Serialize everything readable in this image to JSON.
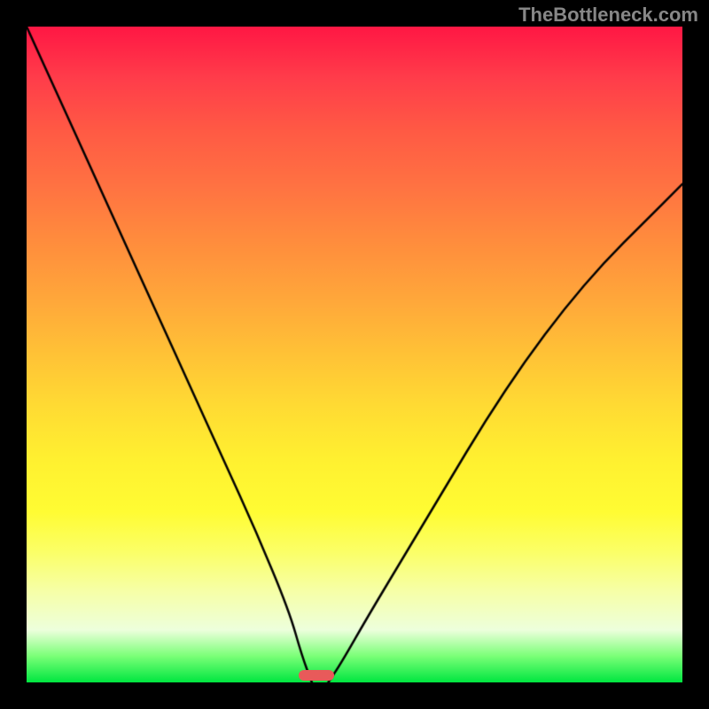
{
  "watermark": "TheBottleneck.com",
  "chart_data": {
    "type": "line",
    "title": "",
    "xlabel": "",
    "ylabel": "",
    "xlim": [
      0,
      100
    ],
    "ylim": [
      0,
      100
    ],
    "gradient_background": {
      "top_color": "#ff1744",
      "mid_color": "#ffdd33",
      "bottom_color": "#00e640"
    },
    "curves": [
      {
        "name": "left_branch",
        "x": [
          0,
          5,
          10,
          15,
          20,
          25,
          30,
          35,
          40,
          42,
          43.5
        ],
        "y": [
          100,
          89,
          78,
          67,
          56,
          45,
          34,
          23,
          11,
          4,
          0
        ]
      },
      {
        "name": "right_branch",
        "x": [
          46,
          48,
          52,
          58,
          64,
          70,
          76,
          82,
          88,
          94,
          100
        ],
        "y": [
          0,
          3,
          10,
          20,
          30,
          40,
          49,
          57,
          64,
          70,
          76
        ]
      }
    ],
    "marker": {
      "name": "minimum_pill",
      "x": 44.5,
      "y": 0.5,
      "color": "#e85a5a"
    }
  }
}
